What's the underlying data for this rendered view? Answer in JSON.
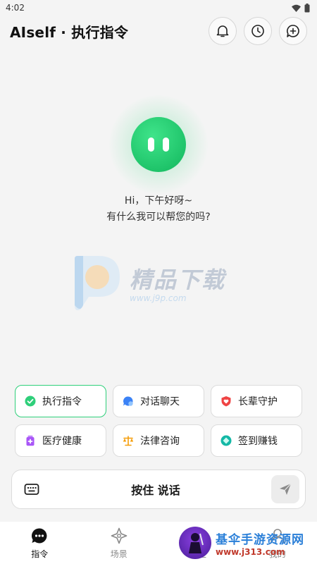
{
  "status_bar": {
    "time": "4:02"
  },
  "header": {
    "title": "AIself · 执行指令"
  },
  "greeting": {
    "line1": "Hi，下午好呀~",
    "line2": "有什么我可以帮您的吗?"
  },
  "watermark": {
    "brand": "精品下载",
    "url": "www.j9p.com"
  },
  "chips": [
    {
      "label": "执行指令",
      "icon": "check-circle-icon",
      "color": "#2fcf7a",
      "active": true
    },
    {
      "label": "对话聊天",
      "icon": "chat-bubble-icon",
      "color": "#3b82f6",
      "active": false
    },
    {
      "label": "长辈守护",
      "icon": "heart-shield-icon",
      "color": "#ef4444",
      "active": false
    },
    {
      "label": "医疗健康",
      "icon": "medicine-icon",
      "color": "#a855f7",
      "active": false
    },
    {
      "label": "法律咨询",
      "icon": "scales-icon",
      "color": "#f59e0b",
      "active": false
    },
    {
      "label": "签到赚钱",
      "icon": "coin-icon",
      "color": "#14b8a6",
      "active": false
    }
  ],
  "input": {
    "hold_to_talk": "按住 说话"
  },
  "nav": [
    {
      "label": "指令",
      "icon": "message-icon",
      "active": true
    },
    {
      "label": "场景",
      "icon": "scene-icon",
      "active": false
    },
    {
      "label": "安全",
      "icon": "shield-icon",
      "active": false
    },
    {
      "label": "我的",
      "icon": "user-icon",
      "active": false
    }
  ],
  "corner_watermark": {
    "title": "基伞手游资源网",
    "url": "www.j313.com"
  },
  "colors": {
    "accent": "#2fcf7a",
    "background": "#f4f4f4"
  }
}
